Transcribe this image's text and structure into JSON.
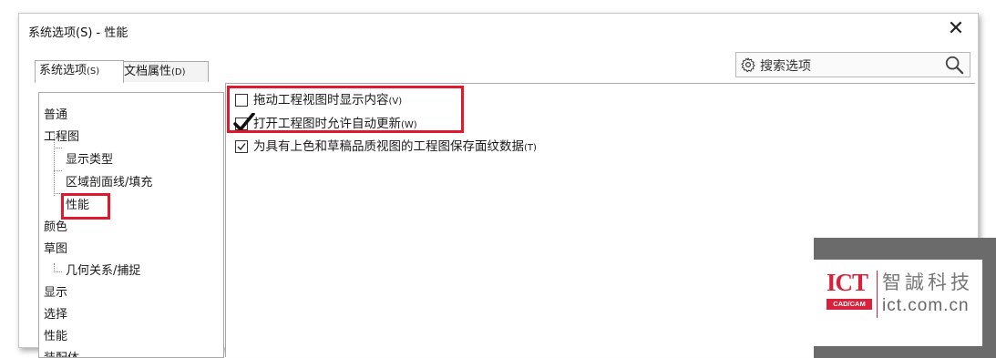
{
  "window": {
    "title": "系统选项(S) - 性能",
    "close_glyph": "✕"
  },
  "tabs": [
    {
      "label": "系统选项",
      "accel": "(S)",
      "active": true
    },
    {
      "label": "文档属性",
      "accel": "(D)",
      "active": false
    }
  ],
  "search": {
    "placeholder": "搜索选项",
    "left_icon": "gear-icon",
    "right_icon": "search-icon"
  },
  "tree": [
    {
      "label": "普通",
      "level": 0
    },
    {
      "label": "工程图",
      "level": 0
    },
    {
      "label": "显示类型",
      "level": 1
    },
    {
      "label": "区域剖面线/填充",
      "level": 1
    },
    {
      "label": "性能",
      "level": 1,
      "selected": true
    },
    {
      "label": "颜色",
      "level": 0
    },
    {
      "label": "草图",
      "level": 0
    },
    {
      "label": "几何关系/捕捉",
      "level": 1
    },
    {
      "label": "显示",
      "level": 0
    },
    {
      "label": "选择",
      "level": 0
    },
    {
      "label": "性能",
      "level": 0
    },
    {
      "label": "装配体",
      "level": 0
    }
  ],
  "options": [
    {
      "label": "拖动工程视图时显示内容",
      "accel": "(V)",
      "checked": false
    },
    {
      "label": "打开工程图时允许自动更新",
      "accel": "(W)",
      "checked": true
    },
    {
      "label": "为具有上色和草稿品质视图的工程图保存面纹数据",
      "accel": "(T)",
      "checked": true
    }
  ],
  "watermark": {
    "logo_text": "ICT",
    "logo_sub": "CAD/CAM",
    "company_cn": "智誠科技",
    "domain": "ict.com.cn"
  },
  "colors": {
    "highlight_red": "#e2182d",
    "logo_red": "#d6223a"
  }
}
